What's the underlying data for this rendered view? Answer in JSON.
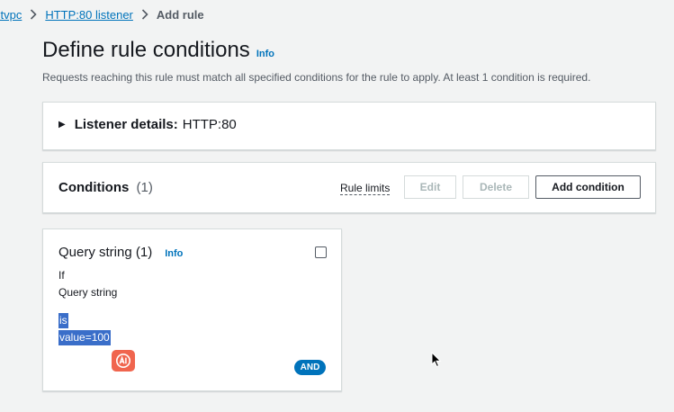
{
  "breadcrumb": {
    "items": [
      "stvpc",
      "HTTP:80 listener"
    ],
    "current": "Add rule"
  },
  "header": {
    "title": "Define rule conditions",
    "info": "Info",
    "description": "Requests reaching this rule must match all specified conditions for the rule to apply. At least 1 condition is required."
  },
  "listener": {
    "label": "Listener details:",
    "value": "HTTP:80"
  },
  "conditions": {
    "title": "Conditions",
    "count": "(1)",
    "rule_limits": "Rule limits",
    "edit_label": "Edit",
    "delete_label": "Delete",
    "add_label": "Add condition"
  },
  "condition_card": {
    "title": "Query string (1)",
    "info": "Info",
    "if_label": "If",
    "field": "Query string",
    "operator": "is",
    "value": "value=100",
    "and_badge": "AND",
    "ai_icon": "ai-icon"
  },
  "colors": {
    "link": "#0073bb",
    "selection": "#3a6ec9",
    "ai_badge": "#f0654e",
    "and_badge": "#0073bb"
  }
}
